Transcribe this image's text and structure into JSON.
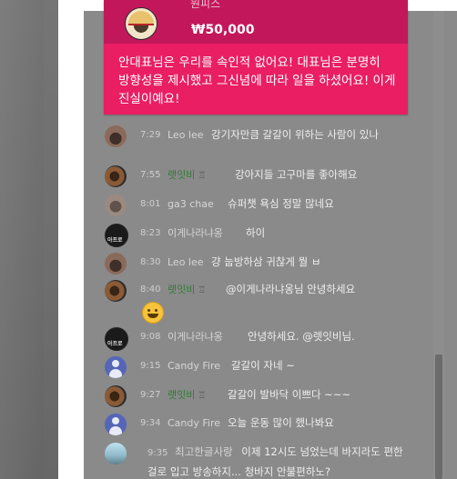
{
  "superchat": {
    "author": "원피스",
    "amount": "₩50,000",
    "message": "안대표님은 우리를 속인적 없어요! 대표님은 분명히 방향성을 제시했고 그신념에 따라 일을 하셨어요! 이게 진실이예요!"
  },
  "messages": [
    {
      "time": "7:29",
      "author": "Leo lee",
      "text": "강기자만큼 갈갈이 위하는 사람이 있나"
    },
    {
      "time": "7:55",
      "author": "랫잇비",
      "badge": "member-badge-icon",
      "text": "강아지들 고구마를 좋아해요"
    },
    {
      "time": "8:01",
      "author": "ga3 chae",
      "text": "슈퍼챗 욕심 정말 많네요"
    },
    {
      "time": "8:23",
      "author": "이게나라냐옹",
      "text": "하이"
    },
    {
      "time": "8:30",
      "author": "Leo lee",
      "text": "걍 눕방하삼 귀찮게 뭘 ㅂ"
    },
    {
      "time": "8:40",
      "author": "랫잇비",
      "badge": "member-badge-icon",
      "text": "@이게나라냐옹님 안녕하세요"
    },
    {
      "time": "9:08",
      "author": "이게나라냐옹",
      "text": "안녕하세요. @렛잇비님."
    },
    {
      "time": "9:15",
      "author": "Candy Fire",
      "text": "갈갈이 자네 ~"
    },
    {
      "time": "9:27",
      "author": "랫잇비",
      "badge": "member-badge-icon",
      "text": "갈갈이 발바닥 이쁘다 ~~~"
    },
    {
      "time": "9:34",
      "author": "Candy Fire",
      "text": "오늘 운동 많이 했나봐요"
    },
    {
      "time": "9:35",
      "author": "최고한글사랑",
      "text": "이제 12시도 넘었는데 바지라도 편한 걸로 입고 방송하지... 청바지 안불편하노?"
    }
  ],
  "colors": {
    "superchat_body": "#e91e63",
    "superchat_header": "#c2185b",
    "member_name": "#2e7d32",
    "chat_background": "#8a8a8a"
  }
}
